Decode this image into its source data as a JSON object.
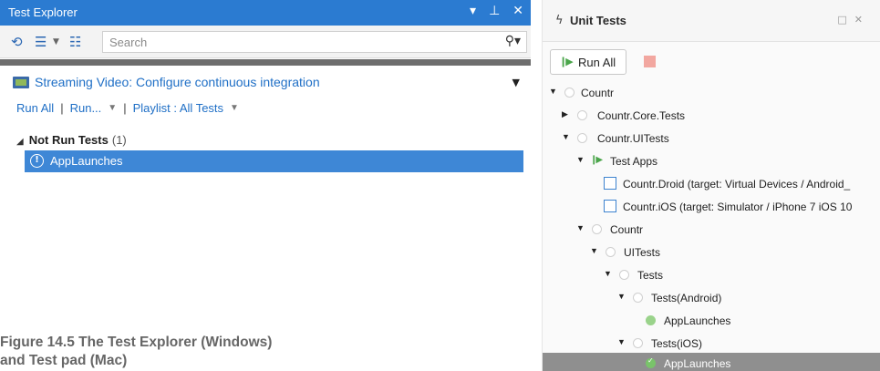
{
  "windows_test_explorer": {
    "title": "Test Explorer",
    "title_buttons": [
      "▾",
      "⊥",
      "✕"
    ],
    "search_placeholder": "Search",
    "playlist_title": "Streaming Video: Configure continuous integration",
    "actions": {
      "run_all": "Run All",
      "run": "Run...",
      "playlist": "Playlist : All Tests"
    },
    "group": {
      "name": "Not Run Tests",
      "count": "(1)"
    },
    "selected_test": "AppLaunches",
    "accent_color": "#2b7bd1"
  },
  "caption": {
    "line1": "Figure 14.5   The Test Explorer (Windows)",
    "line2": "and Test pad (Mac)"
  },
  "mac_unit_tests": {
    "title": "Unit Tests",
    "run_all_label": "Run All",
    "tree": [
      {
        "label": "Countr"
      },
      {
        "label": "Countr.Core.Tests"
      },
      {
        "label": "Countr.UITests"
      },
      {
        "label": "Test Apps"
      },
      {
        "label": "Countr.Droid (target: Virtual Devices / Android_"
      },
      {
        "label": "Countr.iOS (target: Simulator / iPhone 7 iOS 10"
      },
      {
        "label": "Countr"
      },
      {
        "label": "UITests"
      },
      {
        "label": "Tests"
      },
      {
        "label": "Tests(Android)"
      },
      {
        "label": "AppLaunches"
      },
      {
        "label": "Tests(iOS)"
      },
      {
        "label": "AppLaunches"
      }
    ]
  }
}
